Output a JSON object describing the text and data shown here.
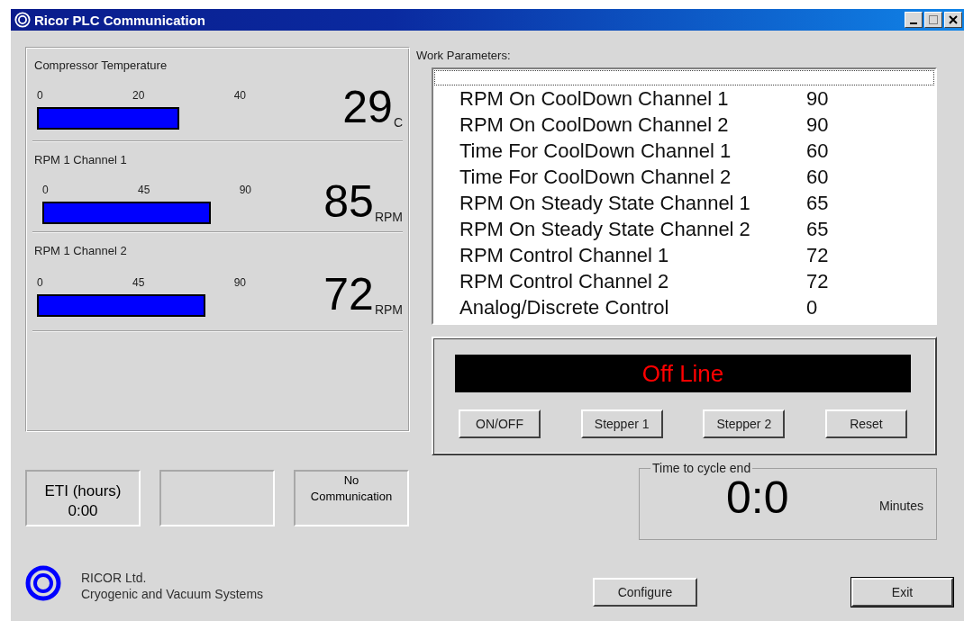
{
  "window": {
    "title": "Ricor PLC Communication"
  },
  "gauges": [
    {
      "title": "Compressor Temperature",
      "ticks": [
        "0",
        "20",
        "40"
      ],
      "value": "29",
      "unit": "C"
    },
    {
      "title": "RPM 1 Channel 1",
      "ticks": [
        "0",
        "45",
        "90"
      ],
      "value": "85",
      "unit": "RPM"
    },
    {
      "title": "RPM 1 Channel 2",
      "ticks": [
        "0",
        "45",
        "90"
      ],
      "value": "72",
      "unit": "RPM"
    }
  ],
  "counters": [
    {
      "kind": "large",
      "lines": [
        "ETI (hours)",
        "0:00"
      ]
    },
    {
      "kind": "empty"
    },
    {
      "kind": "small",
      "lines": [
        "No",
        "Communication"
      ]
    }
  ],
  "company": {
    "name": "RICOR Ltd.",
    "tagline": "Cryogenic and Vacuum Systems"
  },
  "parameters": {
    "label": "Work Parameters:",
    "rows": [
      {
        "name": "RPM On CoolDown Channel 1",
        "value": "90"
      },
      {
        "name": "RPM On CoolDown Channel 2",
        "value": "90"
      },
      {
        "name": "Time For CoolDown Channel 1",
        "value": "60"
      },
      {
        "name": "Time For CoolDown Channel 2",
        "value": "60"
      },
      {
        "name": "RPM On Steady State Channel 1",
        "value": "65"
      },
      {
        "name": "RPM On Steady State Channel 2",
        "value": "65"
      },
      {
        "name": "RPM Control Channel 1",
        "value": "72"
      },
      {
        "name": "RPM Control Channel 2",
        "value": "72"
      },
      {
        "name": "Analog/Discrete Control",
        "value": "0"
      }
    ]
  },
  "status": {
    "display": "Off Line",
    "buttons": [
      "ON/OFF",
      "Stepper 1",
      "Stepper 2",
      "Reset"
    ]
  },
  "timer": {
    "legend": "Time to cycle end",
    "value": "0:0",
    "unit": "Minutes"
  },
  "buttons": [
    "Configure",
    "Exit"
  ]
}
